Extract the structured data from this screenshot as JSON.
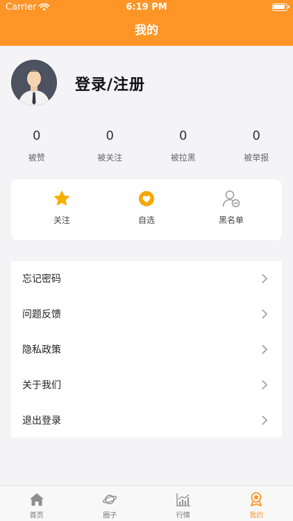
{
  "status_bar": {
    "carrier": "Carrier",
    "time": "6:19 PM",
    "battery_level": 0.95
  },
  "nav": {
    "title": "我的"
  },
  "profile": {
    "login_label": "登录/注册"
  },
  "stats": [
    {
      "value": "0",
      "label": "被赞"
    },
    {
      "value": "0",
      "label": "被关注"
    },
    {
      "value": "0",
      "label": "被拉黑"
    },
    {
      "value": "0",
      "label": "被举报"
    }
  ],
  "quick_actions": [
    {
      "label": "关注",
      "icon": "star-icon"
    },
    {
      "label": "自选",
      "icon": "heart-icon"
    },
    {
      "label": "黑名单",
      "icon": "user-block-icon"
    }
  ],
  "menu": [
    {
      "label": "忘记密码"
    },
    {
      "label": "问题反馈"
    },
    {
      "label": "隐私政策"
    },
    {
      "label": "关于我们"
    },
    {
      "label": "退出登录"
    }
  ],
  "tabs": [
    {
      "label": "首页",
      "icon": "home-icon"
    },
    {
      "label": "圈子",
      "icon": "planet-icon"
    },
    {
      "label": "行情",
      "icon": "chart-icon"
    },
    {
      "label": "我的",
      "icon": "medal-icon",
      "active": true
    }
  ],
  "colors": {
    "accent": "#ff9526",
    "star": "#f5b100"
  }
}
